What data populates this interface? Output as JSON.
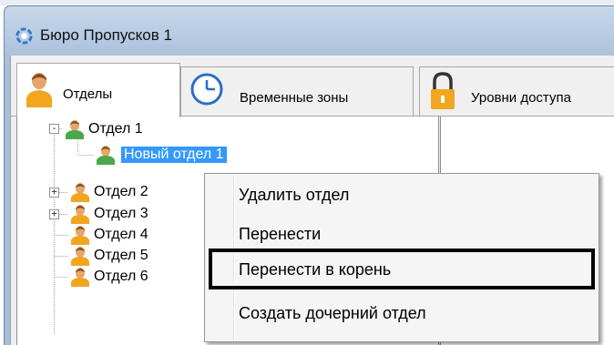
{
  "window": {
    "title": "Бюро Пропусков 1"
  },
  "tabs": [
    {
      "label": "Отделы",
      "icon": "person-icon",
      "active": true
    },
    {
      "label": "Временные зоны",
      "icon": "clock-icon",
      "active": false
    },
    {
      "label": "Уровни доступа",
      "icon": "lock-icon",
      "active": false
    }
  ],
  "tree": {
    "items": [
      {
        "label": "Отдел 1",
        "expander": "-"
      },
      {
        "label": "Новый отдел 1",
        "selected": true
      },
      {
        "label": "Отдел 2",
        "expander": "+"
      },
      {
        "label": "Отдел 3",
        "expander": "+"
      },
      {
        "label": "Отдел 4"
      },
      {
        "label": "Отдел 5"
      },
      {
        "label": "Отдел 6"
      }
    ]
  },
  "context_menu": {
    "items": [
      {
        "label": "Удалить отдел"
      },
      {
        "label": "Перенести"
      },
      {
        "label": "Перенести в корень",
        "highlighted": true
      },
      {
        "label": "Создать дочерний отдел"
      }
    ]
  },
  "colors": {
    "selection": "#3399ff",
    "titlebar": "#b3c8e0",
    "highlight_border": "#000000"
  }
}
